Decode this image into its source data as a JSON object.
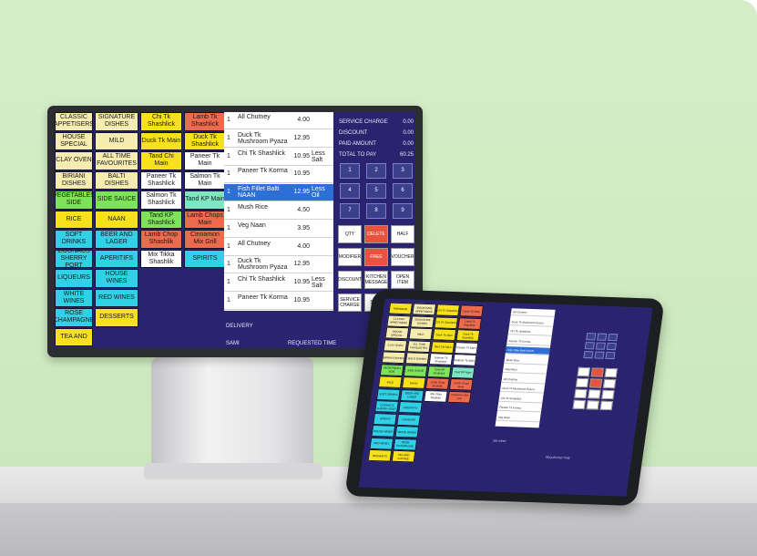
{
  "monitor": {
    "categories": [
      {
        "label": "CLASSIC APPETISERS",
        "color": "#f6ecb0"
      },
      {
        "label": "SIGNATURE DISHES",
        "color": "#f6ecb0"
      },
      {
        "label": "Chi Tk Shashlick",
        "color": "#f7e11a"
      },
      {
        "label": "Lamb Tk Shashlick",
        "color": "#ee6a4d"
      },
      {
        "label": "HOUSE SPECIAL",
        "color": "#f6ecb0"
      },
      {
        "label": "MILD",
        "color": "#f6ecb0"
      },
      {
        "label": "Duck Tk Main",
        "color": "#f7e11a"
      },
      {
        "label": "Duck Tk Shashlick",
        "color": "#f7e11a"
      },
      {
        "label": "CLAY OVEN",
        "color": "#f6ecb0"
      },
      {
        "label": "ALL TIME FAVOURITES",
        "color": "#f6ecb0"
      },
      {
        "label": "Tand Chi Main",
        "color": "#f7e11a"
      },
      {
        "label": "Paneer Tk Main",
        "color": "#ffffff"
      },
      {
        "label": "BIRIANI DISHES",
        "color": "#f6ecb0"
      },
      {
        "label": "BALTI DISHES",
        "color": "#f6ecb0"
      },
      {
        "label": "Paneer Tk Shashlick",
        "color": "#ffffff"
      },
      {
        "label": "Salmon Tk Main",
        "color": "#ffffff"
      },
      {
        "label": "VEGETABLES SIDE",
        "color": "#7fe35a"
      },
      {
        "label": "SIDE SAUCE",
        "color": "#7fe35a"
      },
      {
        "label": "Salmon Tk Shashlick",
        "color": "#ffffff"
      },
      {
        "label": "Tand KP Main",
        "color": "#7fe5c2"
      },
      {
        "label": "RICE",
        "color": "#f7e11a"
      },
      {
        "label": "NAAN",
        "color": "#f7e11a"
      },
      {
        "label": "Tand KP Shashlick",
        "color": "#7fe35a"
      },
      {
        "label": "Lamb Chops Main",
        "color": "#ee6a4d"
      },
      {
        "label": "SOFT DRINKS",
        "color": "#30d1e6"
      },
      {
        "label": "BEER AND LAGER",
        "color": "#30d1e6"
      },
      {
        "label": "Lamb Chop Shashlik",
        "color": "#ee6a4d"
      },
      {
        "label": "Cinnamon Mix Grill",
        "color": "#ee6a4d"
      },
      {
        "label": "COGNACS SHERRY PORT",
        "color": "#30d1e6"
      },
      {
        "label": "APERITIFS",
        "color": "#30d1e6"
      },
      {
        "label": "Mix Tikka Shashlik",
        "color": "#ffffff"
      },
      {
        "label": "SPIRITS",
        "color": "#30d1e6"
      },
      {
        "label": "LIQUEURS",
        "color": "#30d1e6"
      },
      {
        "label": "HOUSE WINES",
        "color": "#30d1e6"
      },
      {
        "label": "WHITE WINES",
        "color": "#30d1e6"
      },
      {
        "label": "RED WINES",
        "color": "#30d1e6"
      },
      {
        "label": "ROSE CHAMPAGNE",
        "color": "#30d1e6"
      },
      {
        "label": "DESSERTS",
        "color": "#f7e11a"
      },
      {
        "label": "TEA AND",
        "color": "#f7e11a"
      }
    ],
    "order_lines": [
      {
        "qty": "1",
        "name": "All Chutney",
        "price": "4.00",
        "mod": ""
      },
      {
        "qty": "1",
        "name": "Duck Tk Mushroom Pyaza",
        "price": "12.95",
        "mod": ""
      },
      {
        "qty": "1",
        "name": "Chi Tk Shashlick",
        "price": "10.95",
        "mod": "Less Salt"
      },
      {
        "qty": "1",
        "name": "Paneer Tk Korma",
        "price": "10.95",
        "mod": ""
      },
      {
        "qty": "1",
        "name": "Fish Fillet Balti NAAN",
        "price": "12.95",
        "mod": "Less Oil"
      },
      {
        "qty": "1",
        "name": "Mush Rice",
        "price": "4.50",
        "mod": ""
      },
      {
        "qty": "1",
        "name": "Veg Naan",
        "price": "3.95",
        "mod": ""
      },
      {
        "qty": "1",
        "name": "All Chutney",
        "price": "4.00",
        "mod": ""
      },
      {
        "qty": "1",
        "name": "Duck Tk Mushroom Pyaza",
        "price": "12.95",
        "mod": ""
      },
      {
        "qty": "1",
        "name": "Chi Tk Shashlick",
        "price": "10.95",
        "mod": "Less Salt"
      },
      {
        "qty": "1",
        "name": "Paneer Tk Korma",
        "price": "10.95",
        "mod": ""
      }
    ],
    "selected_line": 4,
    "summary": [
      {
        "label": "SERVICE CHARGE",
        "value": "0.00"
      },
      {
        "label": "DISCOUNT",
        "value": "0.00"
      },
      {
        "label": "PAID AMOUNT",
        "value": "0.00"
      },
      {
        "label": "TOTAL TO PAY",
        "value": "60.25"
      }
    ],
    "keypad": [
      "1",
      "2",
      "3",
      "4",
      "5",
      "6",
      "7",
      "8",
      "9"
    ],
    "actions": [
      {
        "label": "QTY",
        "style": "plain"
      },
      {
        "label": "DELETE",
        "style": "red"
      },
      {
        "label": "HALF",
        "style": "plain"
      },
      {
        "label": "MODIFIER",
        "style": "plain"
      },
      {
        "label": "FREE",
        "style": "red"
      },
      {
        "label": "VOUCHER",
        "style": "plain"
      },
      {
        "label": "DISCOUNT",
        "style": "plain"
      },
      {
        "label": "KITCHEN MESSAGE",
        "style": "plain"
      },
      {
        "label": "OPEN ITEM",
        "style": "plain"
      },
      {
        "label": "SERVICE CHARGE",
        "style": "plain"
      },
      {
        "label": "SAVE",
        "style": "plain"
      }
    ],
    "footer": {
      "delivery": "DELIVERY",
      "staff": "SAMI",
      "requested": "REQUESTED TIME"
    }
  },
  "tablet": {
    "categories": [
      {
        "label": "POPADOM",
        "color": "#f7e11a"
      },
      {
        "label": "SIGNATURE APPETISERS",
        "color": "#f6ecb0"
      },
      {
        "label": "Chi Tk Shashlick",
        "color": "#f7e11a"
      },
      {
        "label": "Lamb Tk Main",
        "color": "#ee6a4d"
      },
      {
        "label": "CLASSIC APPETISERS",
        "color": "#f6ecb0"
      },
      {
        "label": "SIGNATURE DISHES",
        "color": "#f6ecb0"
      },
      {
        "label": "Chi Tk Shashlick",
        "color": "#f7e11a"
      },
      {
        "label": "Lamb Tk Shashlick",
        "color": "#ee6a4d"
      },
      {
        "label": "HOUSE SPECIAL",
        "color": "#f6ecb0"
      },
      {
        "label": "MILD",
        "color": "#f6ecb0"
      },
      {
        "label": "Duck Tk Main",
        "color": "#f7e11a"
      },
      {
        "label": "Duck Tk Shashlick",
        "color": "#f7e11a"
      },
      {
        "label": "CLAY OVEN",
        "color": "#f6ecb0"
      },
      {
        "label": "ALL TIME FAVOURITES",
        "color": "#f6ecb0"
      },
      {
        "label": "Tand Chi Main",
        "color": "#f7e11a"
      },
      {
        "label": "Paneer Tk Main",
        "color": "#ffffff"
      },
      {
        "label": "BIRIANI DISHES",
        "color": "#f6ecb0"
      },
      {
        "label": "BALTI DISHES",
        "color": "#f6ecb0"
      },
      {
        "label": "Salmon Tk Shashlick",
        "color": "#ffffff"
      },
      {
        "label": "Salmon Tk Main",
        "color": "#ffffff"
      },
      {
        "label": "VEGETABLES SIDE",
        "color": "#7fe35a"
      },
      {
        "label": "SIDE SAUCE",
        "color": "#7fe35a"
      },
      {
        "label": "Tand KP Shashlick",
        "color": "#7fe35a"
      },
      {
        "label": "Tand KP Main",
        "color": "#7fe5c2"
      },
      {
        "label": "RICE",
        "color": "#f7e11a"
      },
      {
        "label": "NAAN",
        "color": "#f7e11a"
      },
      {
        "label": "Lamb Chop Shashlik",
        "color": "#ee6a4d"
      },
      {
        "label": "Lamb Chops Main",
        "color": "#ee6a4d"
      },
      {
        "label": "SOFT DRINKS",
        "color": "#30d1e6"
      },
      {
        "label": "BEER AND LAGER",
        "color": "#30d1e6"
      },
      {
        "label": "Mix Tikka Shashlik",
        "color": "#ffffff"
      },
      {
        "label": "Cinnamon Mix Grill",
        "color": "#ee6a4d"
      },
      {
        "label": "COGNACS SHERRY PORT",
        "color": "#30d1e6"
      },
      {
        "label": "APERITIFS",
        "color": "#30d1e6"
      },
      {
        "label": "",
        "color": "#2a2470"
      },
      {
        "label": "",
        "color": "#2a2470"
      },
      {
        "label": "SPIRITS",
        "color": "#30d1e6"
      },
      {
        "label": "LIQUEURS",
        "color": "#30d1e6"
      },
      {
        "label": "",
        "color": "#2a2470"
      },
      {
        "label": "",
        "color": "#2a2470"
      },
      {
        "label": "HOUSE WINES",
        "color": "#30d1e6"
      },
      {
        "label": "WHITE WINES",
        "color": "#30d1e6"
      },
      {
        "label": "",
        "color": "#2a2470"
      },
      {
        "label": "",
        "color": "#2a2470"
      },
      {
        "label": "RED WINES",
        "color": "#30d1e6"
      },
      {
        "label": "ROSE CHAMPAGNE",
        "color": "#30d1e6"
      },
      {
        "label": "",
        "color": "#2a2470"
      },
      {
        "label": "",
        "color": "#2a2470"
      },
      {
        "label": "DESSERTS",
        "color": "#f7e11a"
      },
      {
        "label": "TEA AND COFFEE",
        "color": "#f7e11a"
      }
    ],
    "order_lines": [
      "All Chutney",
      "Duck Tk Mushroom Pyaza",
      "Chi Tk Shashlick",
      "Paneer Tk Korma",
      "Fish Fillet Balti NAAN",
      "Mush Rice",
      "Veg Naan",
      "All Chutney",
      "Duck Tk Mushroom Pyaza",
      "Chi Tk Shashlick",
      "Paneer Tk Korma",
      "Veg Naan"
    ],
    "selected_line": 4,
    "footer": {
      "delivery": "DELIVERY",
      "requested": "REQUESTED TIME"
    }
  }
}
